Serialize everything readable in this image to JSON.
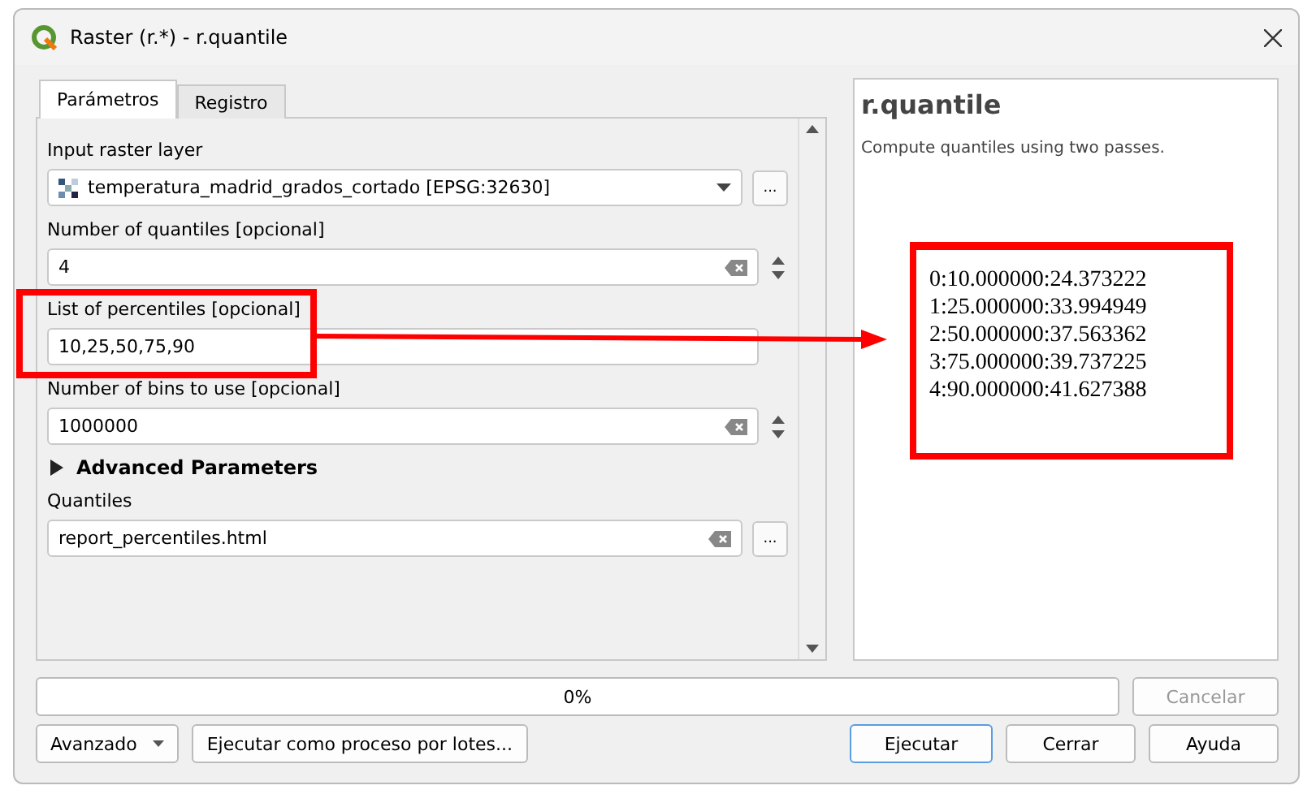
{
  "window": {
    "title": "Raster (r.*) - r.quantile"
  },
  "tabs": [
    {
      "label": "Parámetros",
      "selected": true
    },
    {
      "label": "Registro",
      "selected": false
    }
  ],
  "parameters": [
    {
      "kind": "layer",
      "label": "Input raster layer",
      "value": "temperatura_madrid_grados_cortado [EPSG:32630]",
      "button": "..."
    },
    {
      "kind": "spin",
      "label": "Number of quantiles [opcional]",
      "value": "4"
    },
    {
      "kind": "text",
      "label": "List of percentiles [opcional]",
      "value": "10,25,50,75,90",
      "highlighted": true
    },
    {
      "kind": "spin",
      "label": "Number of bins to use [opcional]",
      "value": "1000000"
    },
    {
      "kind": "section",
      "label": "Advanced Parameters",
      "expanded": false
    },
    {
      "kind": "file",
      "label": "Quantiles",
      "value": "report_percentiles.html",
      "button": "..."
    }
  ],
  "help": {
    "title": "r.quantile",
    "description": "Compute quantiles using two passes.",
    "output": [
      "0:10.000000:24.373222",
      "1:25.000000:33.994949",
      "2:50.000000:37.563362",
      "3:75.000000:39.737225",
      "4:90.000000:41.627388"
    ]
  },
  "progress": {
    "level": 0,
    "text": "0%"
  },
  "cancel_button": {
    "label": "Cancelar",
    "disabled": true
  },
  "buttons": [
    {
      "label": "Avanzado",
      "kind": "menu"
    },
    {
      "label": "Ejecutar como proceso por lotes...",
      "kind": "plain"
    },
    {
      "label": "Ejecutar",
      "kind": "default"
    },
    {
      "label": "Cerrar",
      "kind": "plain"
    },
    {
      "label": "Ayuda",
      "kind": "plain"
    }
  ]
}
